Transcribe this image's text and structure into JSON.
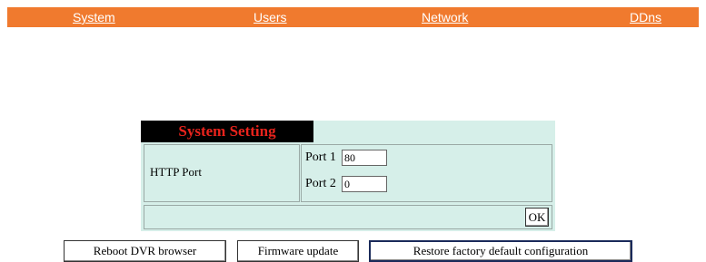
{
  "nav": {
    "system": "System",
    "users": "Users",
    "network": "Network",
    "ddns": "DDns"
  },
  "panel": {
    "title": "System Setting",
    "http_port_label": "HTTP Port",
    "port1_label": "Port 1",
    "port1_value": "80",
    "port2_label": "Port 2",
    "port2_value": "0",
    "ok_label": "OK"
  },
  "buttons": {
    "reboot": "Reboot DVR browser",
    "firmware": "Firmware update",
    "restore": "Restore factory default configuration"
  },
  "colors": {
    "nav_bg": "#f07a2e",
    "panel_bg": "#d6efe9",
    "title_bg": "#000000",
    "title_text": "#e8231c"
  }
}
